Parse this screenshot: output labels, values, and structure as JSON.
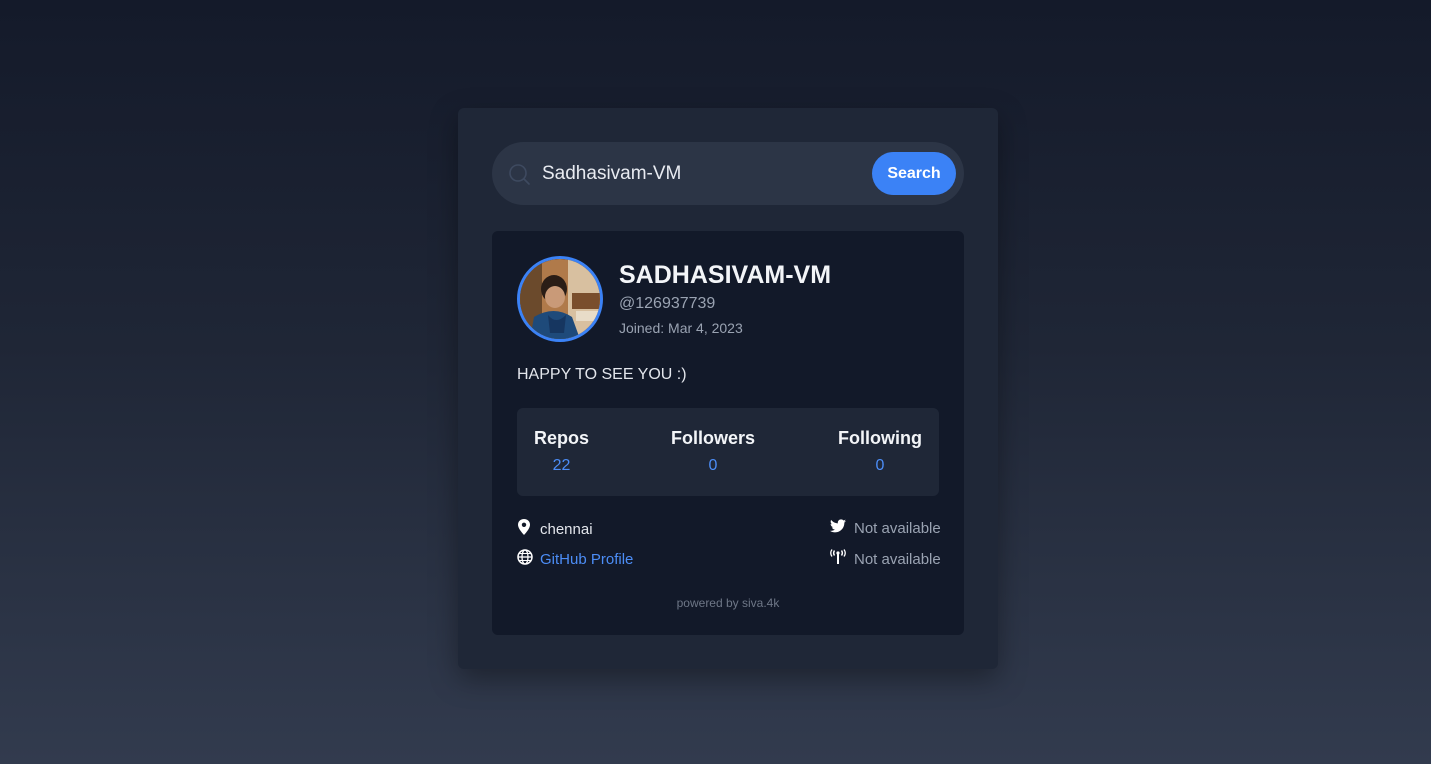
{
  "search": {
    "value": "Sadhasivam-VM",
    "icon": "search-icon",
    "button_label": "Search"
  },
  "profile": {
    "name": "SADHASIVAM-VM",
    "handle": "@126937739",
    "joined": "Joined: Mar 4, 2023",
    "bio": "HAPPY TO SEE YOU :)"
  },
  "stats": {
    "repos_label": "Repos",
    "repos_value": "22",
    "followers_label": "Followers",
    "followers_value": "0",
    "following_label": "Following",
    "following_value": "0"
  },
  "info": {
    "location": "chennai",
    "website": "GitHub Profile",
    "twitter": "Not available",
    "company": "Not available"
  },
  "footer": {
    "powered": "powered by siva.4k"
  },
  "colors": {
    "accent": "#3b82f6",
    "card_bg": "#121929",
    "panel_bg": "#1f2737"
  }
}
